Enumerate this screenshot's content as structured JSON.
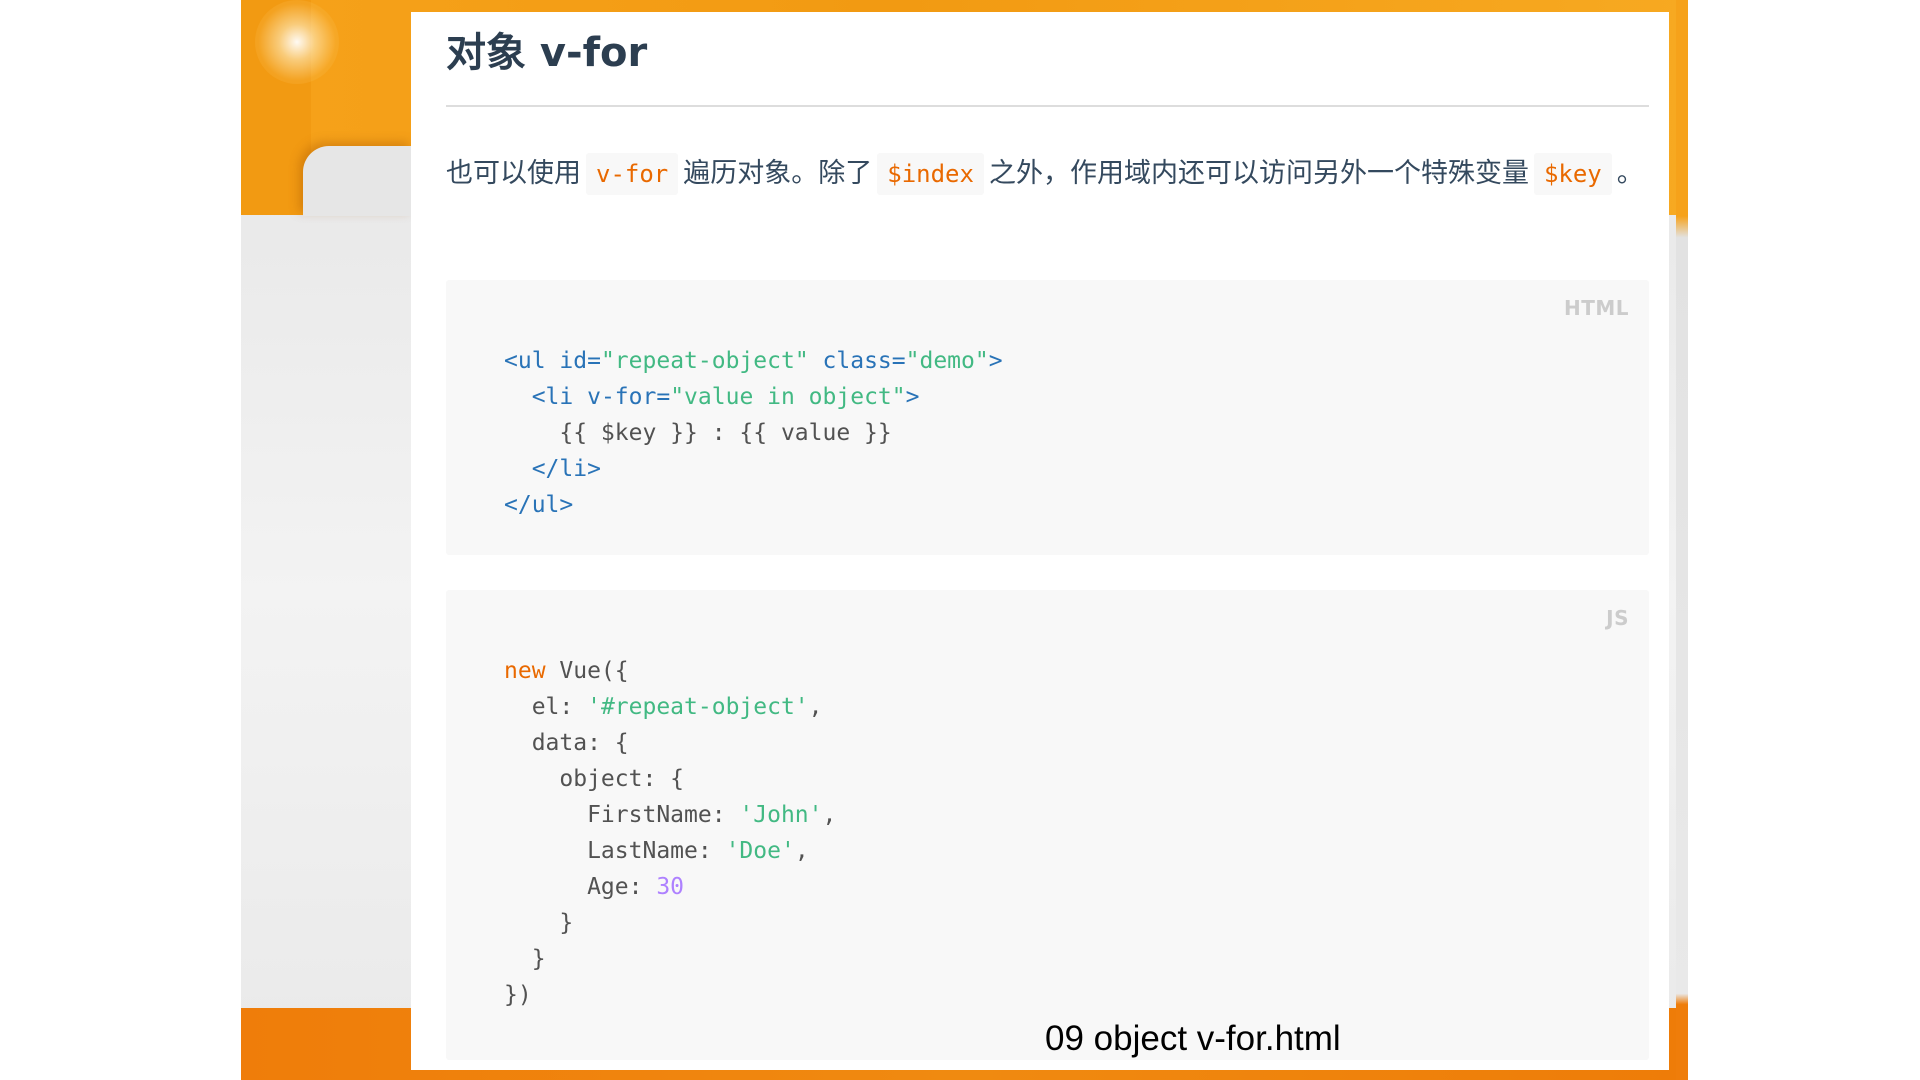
{
  "slide": {
    "heading": "对象 v-for",
    "paragraph": {
      "part1": "也可以使用",
      "code1": "v-for",
      "part2": "遍历对象。除了",
      "code2": "$index",
      "part3": "之外，作用域内还可以访问另外一个特殊变量",
      "code3": "$key",
      "part4": "。"
    },
    "html_block": {
      "label": "HTML",
      "lines": [
        [
          {
            "t": "tag",
            "v": "<ul"
          },
          {
            "t": "txt",
            "v": " "
          },
          {
            "t": "tag",
            "v": "id="
          },
          {
            "t": "str",
            "v": "\"repeat-object\""
          },
          {
            "t": "txt",
            "v": " "
          },
          {
            "t": "tag",
            "v": "class="
          },
          {
            "t": "str",
            "v": "\"demo\""
          },
          {
            "t": "tag",
            "v": ">"
          }
        ],
        [
          {
            "t": "txt",
            "v": "  "
          },
          {
            "t": "tag",
            "v": "<li"
          },
          {
            "t": "txt",
            "v": " "
          },
          {
            "t": "tag",
            "v": "v-for="
          },
          {
            "t": "str",
            "v": "\"value in object\""
          },
          {
            "t": "tag",
            "v": ">"
          }
        ],
        [
          {
            "t": "txt",
            "v": "    {{ $key }} : {{ value }}"
          }
        ],
        [
          {
            "t": "txt",
            "v": "  "
          },
          {
            "t": "tag",
            "v": "</li>"
          }
        ],
        [
          {
            "t": "tag",
            "v": "</ul>"
          }
        ]
      ]
    },
    "js_block": {
      "label": "JS",
      "lines": [
        [
          {
            "t": "kw",
            "v": "new"
          },
          {
            "t": "txt",
            "v": " Vue({"
          }
        ],
        [
          {
            "t": "txt",
            "v": "  el: "
          },
          {
            "t": "str",
            "v": "'#repeat-object'"
          },
          {
            "t": "txt",
            "v": ","
          }
        ],
        [
          {
            "t": "txt",
            "v": "  data: {"
          }
        ],
        [
          {
            "t": "txt",
            "v": "    object: {"
          }
        ],
        [
          {
            "t": "txt",
            "v": "      FirstName: "
          },
          {
            "t": "str",
            "v": "'John'"
          },
          {
            "t": "txt",
            "v": ","
          }
        ],
        [
          {
            "t": "txt",
            "v": "      LastName: "
          },
          {
            "t": "str",
            "v": "'Doe'"
          },
          {
            "t": "txt",
            "v": ","
          }
        ],
        [
          {
            "t": "txt",
            "v": "      Age: "
          },
          {
            "t": "num",
            "v": "30"
          }
        ],
        [
          {
            "t": "txt",
            "v": "    }"
          }
        ],
        [
          {
            "t": "txt",
            "v": "  }"
          }
        ],
        [
          {
            "t": "txt",
            "v": "})"
          }
        ]
      ]
    },
    "caption": "09 object v-for.html"
  },
  "colors": {
    "tag": "#2973b7",
    "string": "#42b983",
    "keyword": "#e96900",
    "number": "#ae81ff",
    "text": "#525252",
    "heading": "#2c3e50",
    "body_text": "#34495e",
    "orange_band": "#f29a12"
  }
}
